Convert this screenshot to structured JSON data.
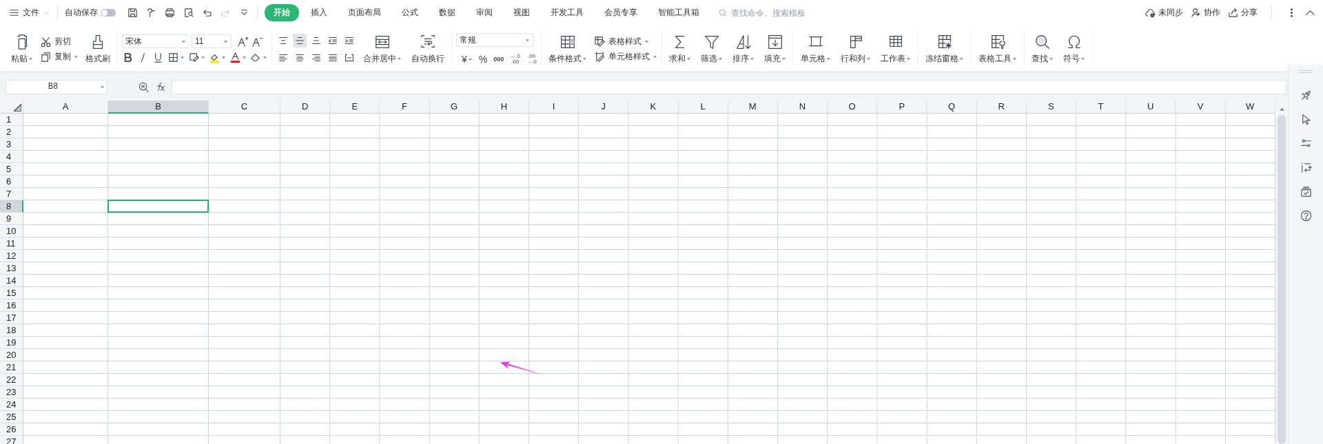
{
  "menu": {
    "label": "文件"
  },
  "autosave": {
    "label": "自动保存",
    "on": false
  },
  "quick_access": [
    {
      "kind": "save",
      "disabled": false
    },
    {
      "kind": "painter",
      "disabled": false
    },
    {
      "kind": "print",
      "disabled": false
    },
    {
      "kind": "preview",
      "disabled": false
    },
    {
      "kind": "undo",
      "disabled": false
    },
    {
      "kind": "redo",
      "disabled": true
    },
    {
      "kind": "more",
      "disabled": false
    }
  ],
  "tabs": [
    {
      "label": "开始",
      "selected": true
    },
    {
      "label": "插入",
      "selected": false
    },
    {
      "label": "页面布局",
      "selected": false
    },
    {
      "label": "公式",
      "selected": false
    },
    {
      "label": "数据",
      "selected": false
    },
    {
      "label": "审阅",
      "selected": false
    },
    {
      "label": "视图",
      "selected": false
    },
    {
      "label": "开发工具",
      "selected": false
    },
    {
      "label": "会员专享",
      "selected": false
    },
    {
      "label": "智能工具箱",
      "selected": false
    }
  ],
  "search": {
    "placeholder": "查找命令、搜索模板"
  },
  "actions": [
    {
      "kind": "cloud",
      "label": "未同步"
    },
    {
      "kind": "user",
      "label": "协作"
    },
    {
      "kind": "share",
      "label": "分享"
    }
  ],
  "ribbon": {
    "clipboard": {
      "paste": "粘贴",
      "cut": "剪切",
      "copy": "复制",
      "painter": "格式刷"
    },
    "font": {
      "name": "宋体",
      "size": "11"
    },
    "alignment": {
      "buttons": [
        {
          "kind": "top",
          "selected": false
        },
        {
          "kind": "middle",
          "selected": true
        },
        {
          "kind": "bottom",
          "selected": false
        },
        {
          "kind": "outdent",
          "selected": false
        },
        {
          "kind": "indent",
          "selected": false
        },
        {
          "kind": "left",
          "selected": false
        },
        {
          "kind": "center",
          "selected": false
        },
        {
          "kind": "right",
          "selected": false
        },
        {
          "kind": "justify",
          "selected": false
        },
        {
          "kind": "distributed",
          "selected": false
        }
      ],
      "merge": "合并居中",
      "wrap": "自动换行"
    },
    "number": {
      "format": "常规",
      "currency": "¥",
      "percent": "%",
      "thousands": "000",
      "increase_decimal": [
        "←.0",
        ".00"
      ],
      "decrease_decimal": [
        ".00",
        "→.0"
      ]
    },
    "styles": {
      "conditional": "条件格式",
      "table_style": "表格样式",
      "cell_style": "单元格样式"
    },
    "large_groups": [
      [
        {
          "kind": "sum",
          "label": "求和"
        },
        {
          "kind": "filter",
          "label": "筛选"
        },
        {
          "kind": "sort",
          "label": "排序"
        },
        {
          "kind": "fill",
          "label": "填充"
        }
      ],
      [
        {
          "kind": "cell",
          "label": "单元格"
        },
        {
          "kind": "rowcol",
          "label": "行和列"
        },
        {
          "kind": "sheet",
          "label": "工作表"
        }
      ],
      [
        {
          "kind": "freeze",
          "label": "冻结窗格"
        }
      ],
      [
        {
          "kind": "tools",
          "label": "表格工具"
        }
      ],
      [
        {
          "kind": "find",
          "label": "查找"
        },
        {
          "kind": "symbol",
          "label": "符号"
        }
      ]
    ]
  },
  "name_box": "B8",
  "sheet": {
    "columns": [
      {
        "label": "A",
        "selected": false
      },
      {
        "label": "B",
        "selected": true
      },
      {
        "label": "C",
        "selected": false
      },
      {
        "label": "D",
        "selected": false
      },
      {
        "label": "E",
        "selected": false
      },
      {
        "label": "F",
        "selected": false
      },
      {
        "label": "G",
        "selected": false
      },
      {
        "label": "H",
        "selected": false
      },
      {
        "label": "I",
        "selected": false
      },
      {
        "label": "J",
        "selected": false
      },
      {
        "label": "K",
        "selected": false
      },
      {
        "label": "L",
        "selected": false
      },
      {
        "label": "M",
        "selected": false
      },
      {
        "label": "N",
        "selected": false
      },
      {
        "label": "O",
        "selected": false
      },
      {
        "label": "P",
        "selected": false
      },
      {
        "label": "Q",
        "selected": false
      },
      {
        "label": "R",
        "selected": false
      },
      {
        "label": "S",
        "selected": false
      },
      {
        "label": "T",
        "selected": false
      },
      {
        "label": "U",
        "selected": false
      },
      {
        "label": "V",
        "selected": false
      },
      {
        "label": "W",
        "selected": false
      }
    ],
    "rows": [
      {
        "label": "1",
        "selected": false
      },
      {
        "label": "2",
        "selected": false
      },
      {
        "label": "3",
        "selected": false
      },
      {
        "label": "4",
        "selected": false
      },
      {
        "label": "5",
        "selected": false
      },
      {
        "label": "6",
        "selected": false
      },
      {
        "label": "7",
        "selected": false
      },
      {
        "label": "8",
        "selected": true
      },
      {
        "label": "9",
        "selected": false
      },
      {
        "label": "10",
        "selected": false
      },
      {
        "label": "11",
        "selected": false
      },
      {
        "label": "12",
        "selected": false
      },
      {
        "label": "13",
        "selected": false
      },
      {
        "label": "14",
        "selected": false
      },
      {
        "label": "15",
        "selected": false
      },
      {
        "label": "16",
        "selected": false
      },
      {
        "label": "17",
        "selected": false
      },
      {
        "label": "18",
        "selected": false
      },
      {
        "label": "19",
        "selected": false
      },
      {
        "label": "20",
        "selected": false
      },
      {
        "label": "21",
        "selected": false
      },
      {
        "label": "22",
        "selected": false
      },
      {
        "label": "23",
        "selected": false
      },
      {
        "label": "24",
        "selected": false
      },
      {
        "label": "25",
        "selected": false
      },
      {
        "label": "26",
        "selected": false
      },
      {
        "label": "27",
        "selected": false
      }
    ]
  },
  "arrow_annotation": true
}
